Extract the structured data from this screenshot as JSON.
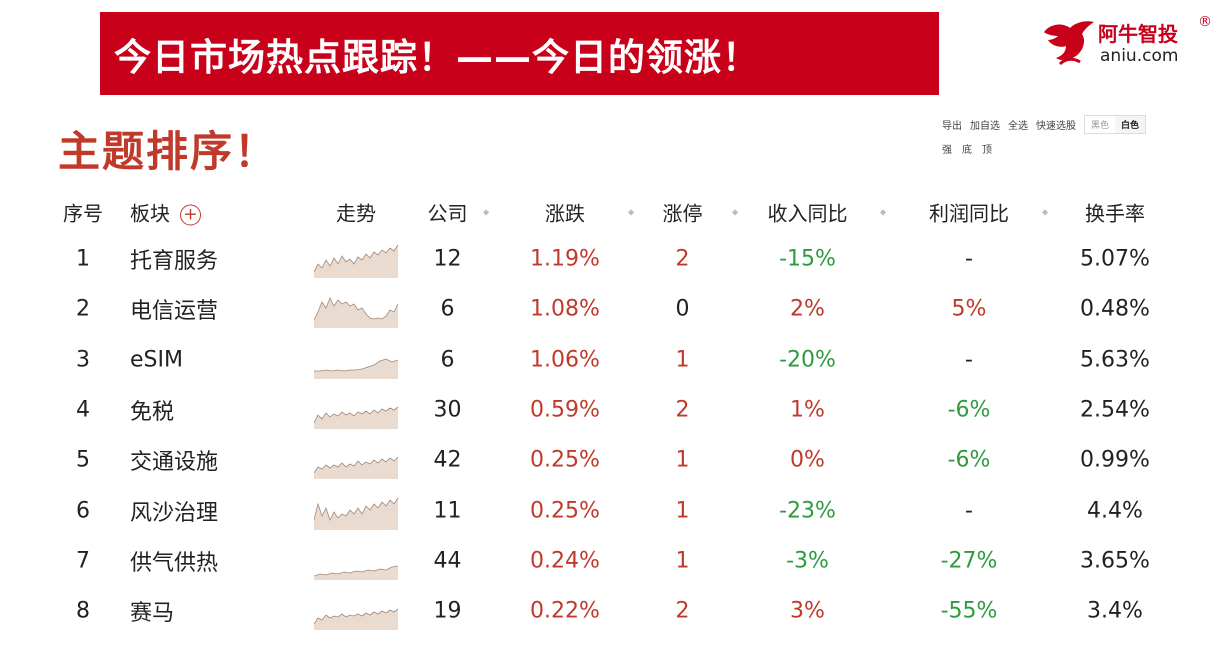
{
  "banner": {
    "title": "今日市场热点跟踪！——今日的领涨！"
  },
  "logo": {
    "cn": "阿牛智投",
    "reg": "®",
    "en": "aniu.com"
  },
  "section_title": "主题排序！",
  "toolbar": {
    "export": "导出",
    "add_watch": "加自选",
    "select_all": "全选",
    "quick_pick": "快速选股",
    "theme_black": "黑色",
    "theme_white": "白色",
    "active_theme": "白色",
    "strong": "强",
    "bottom": "底",
    "top": "顶"
  },
  "colors": {
    "up": "#c0392b",
    "down": "#2e9b3f",
    "banner": "#c8001a"
  },
  "table": {
    "headers": {
      "index": "序号",
      "name": "板块",
      "trend": "走势",
      "company": "公司",
      "change": "涨跌",
      "limit_up": "涨停",
      "revenue_yoy": "收入同比",
      "profit_yoy": "利润同比",
      "turnover": "换手率"
    },
    "rows": [
      {
        "index": "1",
        "name": "托育服务",
        "company": "12",
        "change": "1.19%",
        "limit_up": "2",
        "revenue_yoy": "-15%",
        "profit_yoy": "-",
        "turnover": "5.07%"
      },
      {
        "index": "2",
        "name": "电信运营",
        "company": "6",
        "change": "1.08%",
        "limit_up": "0",
        "revenue_yoy": "2%",
        "profit_yoy": "5%",
        "turnover": "0.48%"
      },
      {
        "index": "3",
        "name": "eSIM",
        "company": "6",
        "change": "1.06%",
        "limit_up": "1",
        "revenue_yoy": "-20%",
        "profit_yoy": "-",
        "turnover": "5.63%"
      },
      {
        "index": "4",
        "name": "免税",
        "company": "30",
        "change": "0.59%",
        "limit_up": "2",
        "revenue_yoy": "1%",
        "profit_yoy": "-6%",
        "turnover": "2.54%"
      },
      {
        "index": "5",
        "name": "交通设施",
        "company": "42",
        "change": "0.25%",
        "limit_up": "1",
        "revenue_yoy": "0%",
        "profit_yoy": "-6%",
        "turnover": "0.99%"
      },
      {
        "index": "6",
        "name": "风沙治理",
        "company": "11",
        "change": "0.25%",
        "limit_up": "1",
        "revenue_yoy": "-23%",
        "profit_yoy": "-",
        "turnover": "4.4%"
      },
      {
        "index": "7",
        "name": "供气供热",
        "company": "44",
        "change": "0.24%",
        "limit_up": "1",
        "revenue_yoy": "-3%",
        "profit_yoy": "-27%",
        "turnover": "3.65%"
      },
      {
        "index": "8",
        "name": "赛马",
        "company": "19",
        "change": "0.22%",
        "limit_up": "2",
        "revenue_yoy": "3%",
        "profit_yoy": "-55%",
        "turnover": "3.4%"
      }
    ]
  }
}
